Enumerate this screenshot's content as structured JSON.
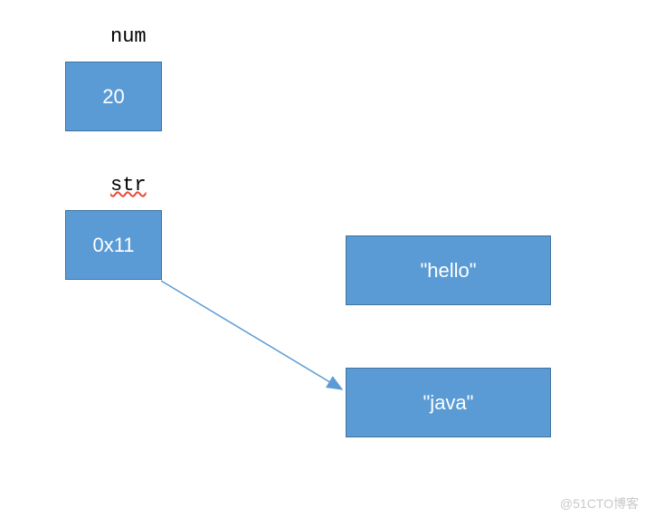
{
  "labels": {
    "num": "num",
    "str": "str"
  },
  "boxes": {
    "numValue": "20",
    "strValue": "0x11",
    "hello": "\"hello\"",
    "java": "\"java\""
  },
  "watermark": "@51CTO博客",
  "chart_data": {
    "type": "diagram",
    "title": "",
    "nodes": [
      {
        "id": "num-label",
        "text": "num",
        "kind": "label"
      },
      {
        "id": "num-box",
        "text": "20",
        "kind": "value-box"
      },
      {
        "id": "str-label",
        "text": "str",
        "kind": "label"
      },
      {
        "id": "str-box",
        "text": "0x11",
        "kind": "pointer-box"
      },
      {
        "id": "hello-box",
        "text": "\"hello\"",
        "kind": "string-box"
      },
      {
        "id": "java-box",
        "text": "\"java\"",
        "kind": "string-box"
      }
    ],
    "edges": [
      {
        "from": "str-box",
        "to": "java-box",
        "style": "arrow"
      }
    ]
  }
}
